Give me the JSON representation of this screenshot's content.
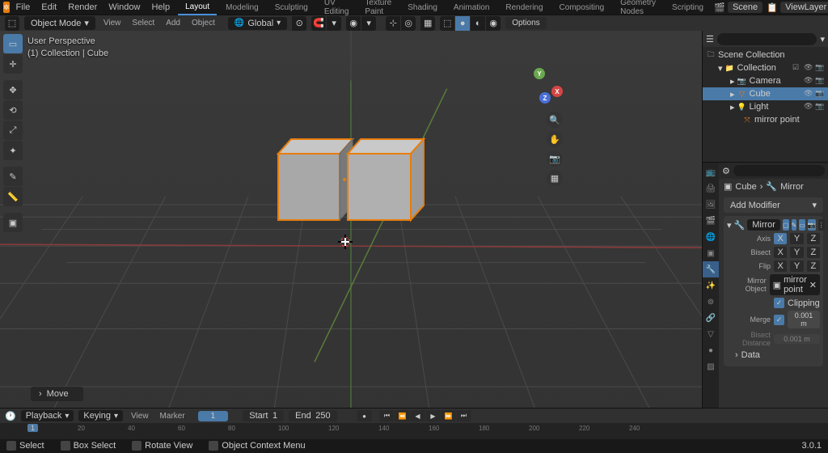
{
  "menu": [
    "File",
    "Edit",
    "Render",
    "Window",
    "Help"
  ],
  "workspace_tabs": [
    "Layout",
    "Modeling",
    "Sculpting",
    "UV Editing",
    "Texture Paint",
    "Shading",
    "Animation",
    "Rendering",
    "Compositing",
    "Geometry Nodes",
    "Scripting"
  ],
  "active_workspace": "Layout",
  "scene_name": "Scene",
  "viewlayer_name": "ViewLayer",
  "header2": {
    "mode": "Object Mode",
    "view": "View",
    "select": "Select",
    "add": "Add",
    "object": "Object",
    "orientation": "Global",
    "options": "Options"
  },
  "viewport_overlay": {
    "line1": "User Perspective",
    "line2": "(1) Collection | Cube"
  },
  "last_op": "Move",
  "outliner": {
    "root": "Scene Collection",
    "collection": "Collection",
    "camera": "Camera",
    "cube": "Cube",
    "light": "Light",
    "mirror_point": "mirror point"
  },
  "properties": {
    "breadcrumb_obj": "Cube",
    "breadcrumb_mod": "Mirror",
    "add_modifier": "Add Modifier",
    "modifier_name": "Mirror",
    "axis_label": "Axis",
    "bisect_label": "Bisect",
    "flip_label": "Flip",
    "axes": [
      "X",
      "Y",
      "Z"
    ],
    "mirror_object_label": "Mirror Object",
    "mirror_object_value": "mirror point",
    "clipping_label": "Clipping",
    "merge_label": "Merge",
    "merge_value": "0.001 m",
    "bisect_distance_label": "Bisect Distance",
    "bisect_distance_value": "0.001 m",
    "data_section": "Data"
  },
  "timeline": {
    "playback": "Playback",
    "keying": "Keying",
    "view": "View",
    "marker": "Marker",
    "current_frame": "1",
    "start_label": "Start",
    "start": "1",
    "end_label": "End",
    "end": "250",
    "ticks": [
      "0",
      "20",
      "40",
      "60",
      "80",
      "100",
      "120",
      "140",
      "160",
      "180",
      "200",
      "220",
      "240"
    ]
  },
  "statusbar": {
    "select": "Select",
    "box_select": "Box Select",
    "rotate": "Rotate View",
    "context": "Object Context Menu",
    "version": "3.0.1"
  }
}
